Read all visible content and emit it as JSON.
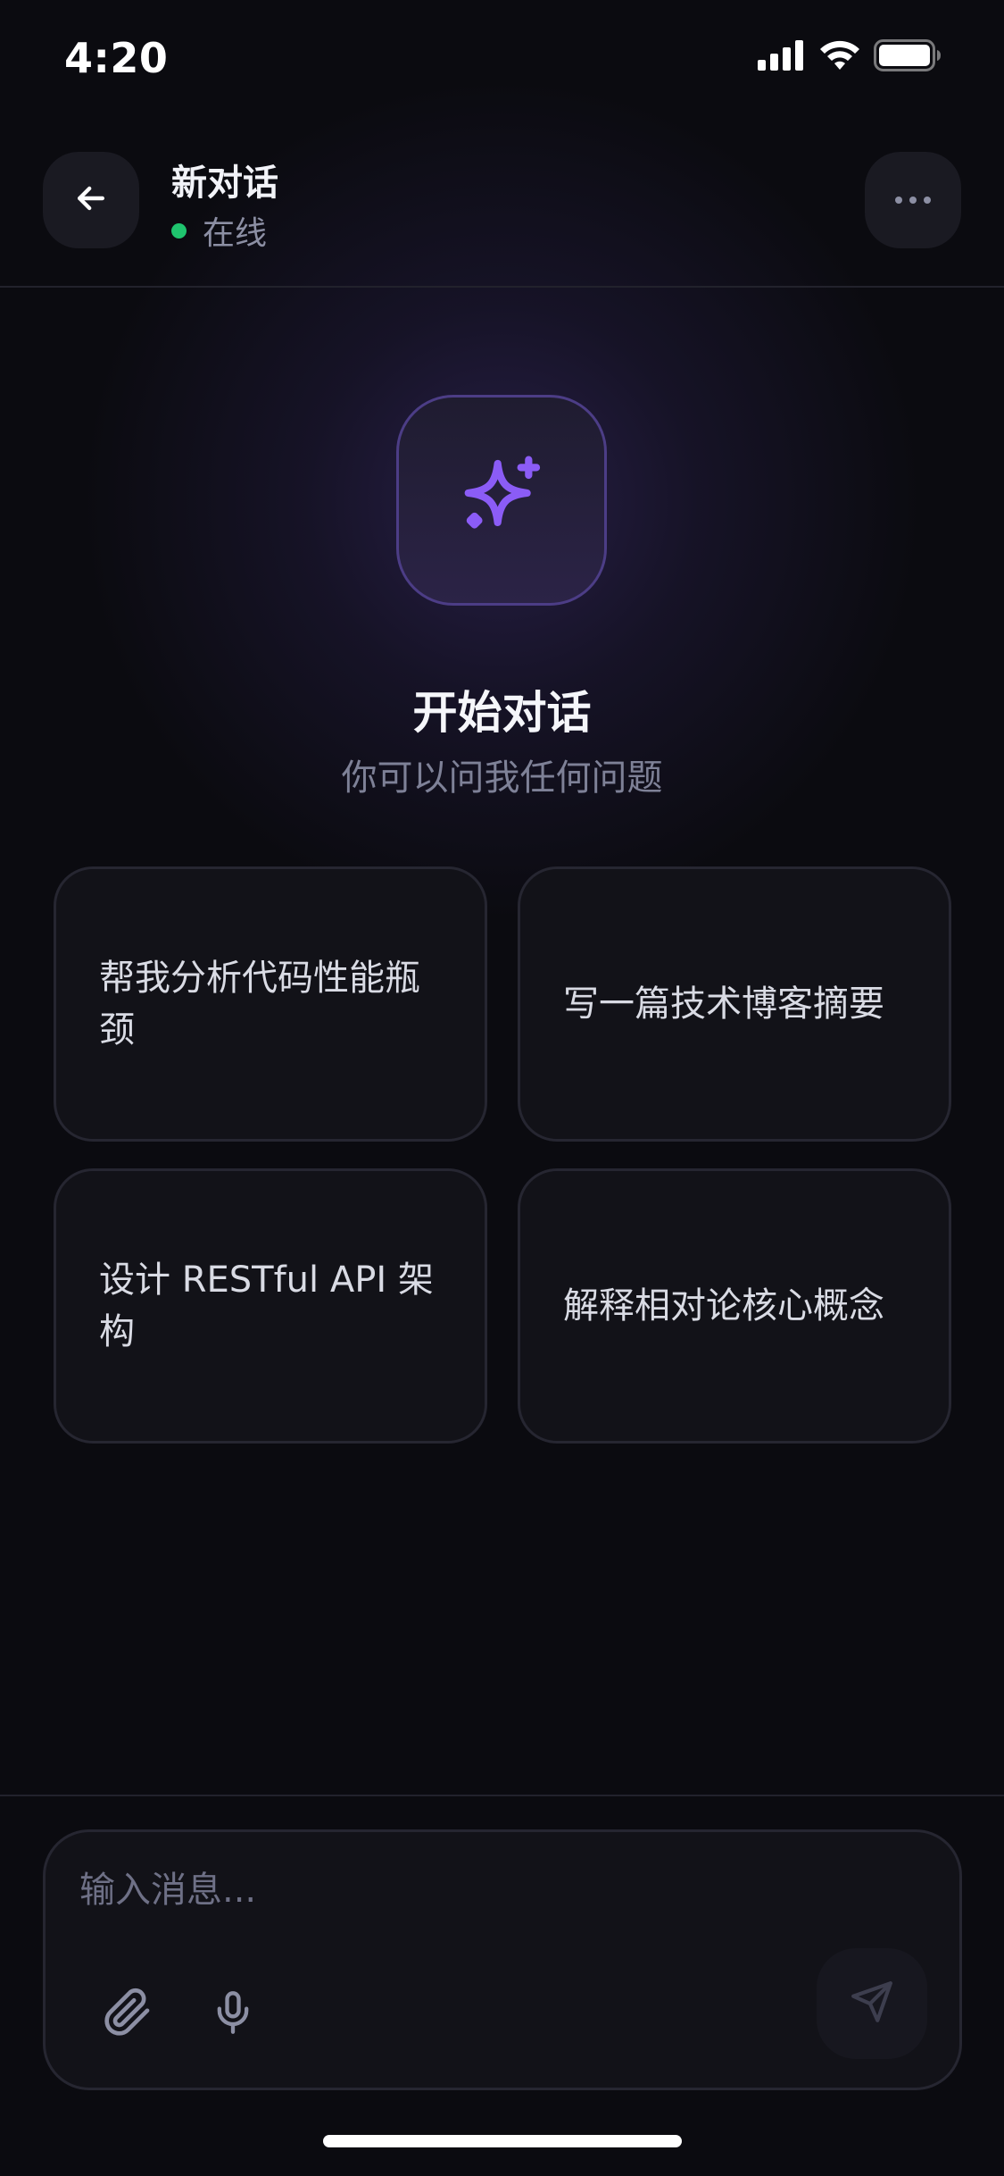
{
  "status_bar": {
    "time": "4:20",
    "signal_icon": "cellular-signal-icon",
    "wifi_icon": "wifi-icon",
    "battery_icon": "battery-full-icon"
  },
  "header": {
    "title": "新对话",
    "status_text": "在线",
    "status_color": "#1fc46e",
    "back_icon": "arrow-left-icon",
    "more_icon": "more-horizontal-icon"
  },
  "hero": {
    "icon": "sparkles-icon",
    "accent_color": "#8b5cf6",
    "title": "开始对话",
    "subtitle": "你可以问我任何问题"
  },
  "suggestions": [
    {
      "label": "帮我分析代码性能瓶颈"
    },
    {
      "label": "写一篇技术博客摘要"
    },
    {
      "label": "设计 RESTful API 架构"
    },
    {
      "label": "解释相对论核心概念"
    }
  ],
  "composer": {
    "placeholder": "输入消息...",
    "attach_icon": "paperclip-icon",
    "mic_icon": "microphone-icon",
    "send_icon": "send-icon"
  }
}
